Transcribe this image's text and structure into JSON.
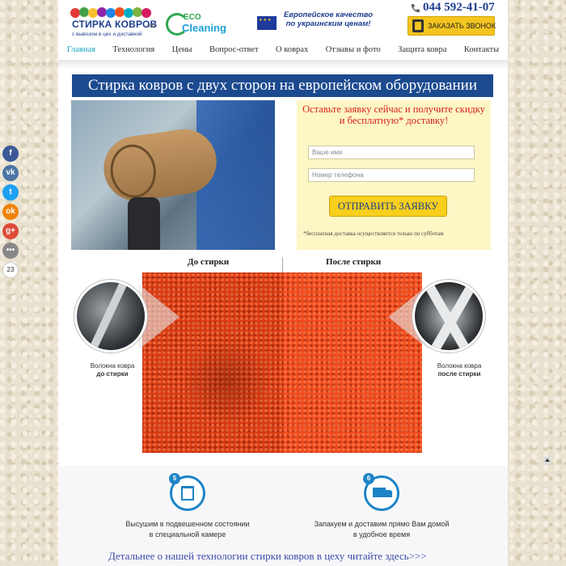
{
  "header": {
    "logo_title": "СТИРКА КОВРОВ",
    "logo_sub": "с вывозом в цех и доставкой",
    "from": "от",
    "eco_line1": "ECO",
    "eco_line2": "Cleaning",
    "eu_text": "Европейское качество по украинским ценам!",
    "phone": "044 592-41-07",
    "callback_label": "ЗАКАЗАТЬ ЗВОНОК"
  },
  "nav": {
    "items": [
      {
        "label": "Главная",
        "active": true
      },
      {
        "label": "Технология"
      },
      {
        "label": "Цены"
      },
      {
        "label": "Вопрос-ответ"
      },
      {
        "label": "О коврах"
      },
      {
        "label": "Отзывы и фото"
      },
      {
        "label": "Защита ковра"
      },
      {
        "label": "Контакты"
      }
    ]
  },
  "hero": {
    "title": "Стирка ковров с двух сторон на европейском оборудовании",
    "form_title": "Оставьте заявку сейчас и получите скидку и бесплатную* доставку!",
    "name_placeholder": "Ваше имя",
    "phone_placeholder": "Номер телефона",
    "submit_label": "ОТПРАВИТЬ ЗАЯВКУ",
    "note": "*бесплатная доставка осуществляется только по субботам"
  },
  "before_after": {
    "before_label": "До стирки",
    "after_label": "После стирки",
    "fiber_before_line1": "Волокна ковра",
    "fiber_before_line2": "до стирки",
    "fiber_after_line1": "Волокна ковра",
    "fiber_after_line2": "после стирки"
  },
  "steps": [
    {
      "num": "5",
      "icon": "hanger-icon",
      "line1": "Высушим в подвешенном состоянии",
      "line2": "в специальной камере"
    },
    {
      "num": "6",
      "icon": "truck-icon",
      "line1": "Запакуем и доставим прямо Вам домой",
      "line2": "в удобное время"
    }
  ],
  "more_link": "Детальнее о нашей технологии стирки ковров в цеху читайте здесь>>>",
  "social": {
    "share_count": "23"
  }
}
